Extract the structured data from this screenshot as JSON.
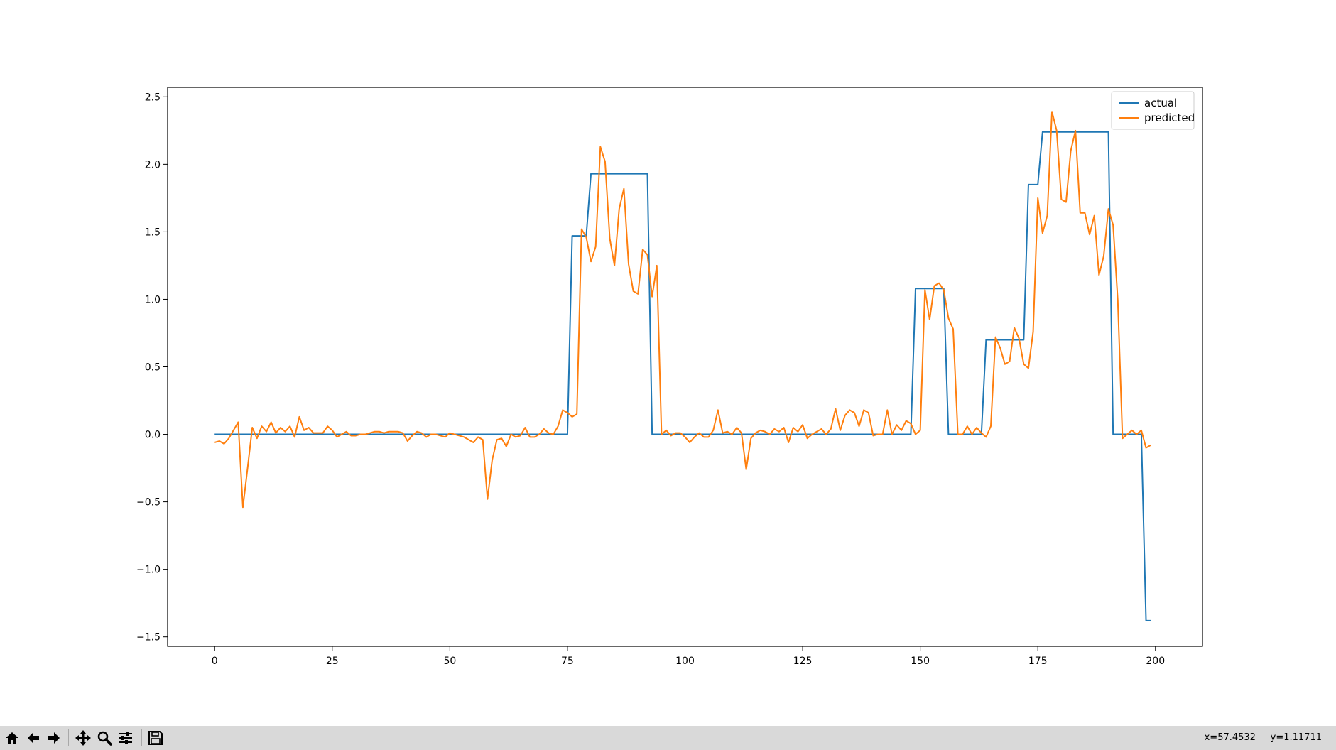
{
  "chart_data": {
    "type": "line",
    "title": "",
    "xlabel": "",
    "ylabel": "",
    "xlim": [
      -10,
      210
    ],
    "ylim": [
      -1.57,
      2.57
    ],
    "xticks": [
      0,
      25,
      50,
      75,
      100,
      125,
      150,
      175,
      200
    ],
    "xtick_labels": [
      "0",
      "25",
      "50",
      "75",
      "100",
      "125",
      "150",
      "175",
      "200"
    ],
    "yticks": [
      -1.5,
      -1.0,
      -0.5,
      0.0,
      0.5,
      1.0,
      1.5,
      2.0,
      2.5
    ],
    "ytick_labels": [
      "−1.5",
      "−1.0",
      "−0.5",
      "0.0",
      "0.5",
      "1.0",
      "1.5",
      "2.0",
      "2.5"
    ],
    "grid": false,
    "legend_position": "top-right",
    "series": [
      {
        "name": "actual",
        "color": "#1f77b4",
        "points": [
          [
            0,
            0
          ],
          [
            75,
            0
          ],
          [
            76,
            1.47
          ],
          [
            79,
            1.47
          ],
          [
            80,
            1.93
          ],
          [
            92,
            1.93
          ],
          [
            93,
            0
          ],
          [
            148,
            0
          ],
          [
            149,
            1.08
          ],
          [
            155,
            1.08
          ],
          [
            156,
            0
          ],
          [
            163,
            0
          ],
          [
            164,
            0.7
          ],
          [
            172,
            0.7
          ],
          [
            173,
            1.85
          ],
          [
            175,
            1.85
          ],
          [
            176,
            2.24
          ],
          [
            190,
            2.24
          ],
          [
            191,
            0
          ],
          [
            197,
            0
          ],
          [
            198,
            -1.38
          ],
          [
            199,
            -1.38
          ]
        ]
      },
      {
        "name": "predicted",
        "color": "#ff7f0e",
        "points": [
          [
            0,
            -0.06
          ],
          [
            1,
            -0.05
          ],
          [
            2,
            -0.07
          ],
          [
            3,
            -0.03
          ],
          [
            4,
            0.03
          ],
          [
            5,
            0.09
          ],
          [
            6,
            -0.54
          ],
          [
            7,
            -0.25
          ],
          [
            8,
            0.05
          ],
          [
            9,
            -0.03
          ],
          [
            10,
            0.06
          ],
          [
            11,
            0.02
          ],
          [
            12,
            0.09
          ],
          [
            13,
            0.01
          ],
          [
            14,
            0.05
          ],
          [
            15,
            0.02
          ],
          [
            16,
            0.06
          ],
          [
            17,
            -0.02
          ],
          [
            18,
            0.13
          ],
          [
            19,
            0.03
          ],
          [
            20,
            0.05
          ],
          [
            21,
            0.01
          ],
          [
            22,
            0.01
          ],
          [
            23,
            0.01
          ],
          [
            24,
            0.06
          ],
          [
            25,
            0.03
          ],
          [
            26,
            -0.02
          ],
          [
            27,
            0.0
          ],
          [
            28,
            0.02
          ],
          [
            29,
            -0.01
          ],
          [
            30,
            -0.01
          ],
          [
            31,
            0.0
          ],
          [
            32,
            0.0
          ],
          [
            33,
            0.01
          ],
          [
            34,
            0.02
          ],
          [
            35,
            0.02
          ],
          [
            36,
            0.01
          ],
          [
            37,
            0.02
          ],
          [
            38,
            0.02
          ],
          [
            39,
            0.02
          ],
          [
            40,
            0.01
          ],
          [
            41,
            -0.05
          ],
          [
            42,
            -0.01
          ],
          [
            43,
            0.02
          ],
          [
            44,
            0.01
          ],
          [
            45,
            -0.02
          ],
          [
            46,
            0.0
          ],
          [
            47,
            0.0
          ],
          [
            48,
            -0.01
          ],
          [
            49,
            -0.02
          ],
          [
            50,
            0.01
          ],
          [
            51,
            0.0
          ],
          [
            52,
            -0.01
          ],
          [
            53,
            -0.02
          ],
          [
            54,
            -0.04
          ],
          [
            55,
            -0.06
          ],
          [
            56,
            -0.02
          ],
          [
            57,
            -0.04
          ],
          [
            58,
            -0.48
          ],
          [
            59,
            -0.19
          ],
          [
            60,
            -0.04
          ],
          [
            61,
            -0.03
          ],
          [
            62,
            -0.09
          ],
          [
            63,
            0.0
          ],
          [
            64,
            -0.02
          ],
          [
            65,
            -0.01
          ],
          [
            66,
            0.05
          ],
          [
            67,
            -0.02
          ],
          [
            68,
            -0.02
          ],
          [
            69,
            0.0
          ],
          [
            70,
            0.04
          ],
          [
            71,
            0.01
          ],
          [
            72,
            0.0
          ],
          [
            73,
            0.06
          ],
          [
            74,
            0.18
          ],
          [
            75,
            0.16
          ],
          [
            76,
            0.13
          ],
          [
            77,
            0.15
          ],
          [
            78,
            1.52
          ],
          [
            79,
            1.46
          ],
          [
            80,
            1.28
          ],
          [
            81,
            1.39
          ],
          [
            82,
            2.13
          ],
          [
            83,
            2.02
          ],
          [
            84,
            1.45
          ],
          [
            85,
            1.25
          ],
          [
            86,
            1.67
          ],
          [
            87,
            1.82
          ],
          [
            88,
            1.26
          ],
          [
            89,
            1.06
          ],
          [
            90,
            1.04
          ],
          [
            91,
            1.37
          ],
          [
            92,
            1.33
          ],
          [
            93,
            1.02
          ],
          [
            94,
            1.25
          ],
          [
            95,
            0.0
          ],
          [
            96,
            0.03
          ],
          [
            97,
            -0.01
          ],
          [
            98,
            0.01
          ],
          [
            99,
            0.01
          ],
          [
            100,
            -0.02
          ],
          [
            101,
            -0.06
          ],
          [
            102,
            -0.02
          ],
          [
            103,
            0.01
          ],
          [
            104,
            -0.02
          ],
          [
            105,
            -0.02
          ],
          [
            106,
            0.03
          ],
          [
            107,
            0.18
          ],
          [
            108,
            0.01
          ],
          [
            109,
            0.02
          ],
          [
            110,
            0.0
          ],
          [
            111,
            0.05
          ],
          [
            112,
            0.01
          ],
          [
            113,
            -0.26
          ],
          [
            114,
            -0.03
          ],
          [
            115,
            0.01
          ],
          [
            116,
            0.03
          ],
          [
            117,
            0.02
          ],
          [
            118,
            0.0
          ],
          [
            119,
            0.04
          ],
          [
            120,
            0.02
          ],
          [
            121,
            0.05
          ],
          [
            122,
            -0.06
          ],
          [
            123,
            0.05
          ],
          [
            124,
            0.02
          ],
          [
            125,
            0.07
          ],
          [
            126,
            -0.03
          ],
          [
            127,
            0.0
          ],
          [
            128,
            0.02
          ],
          [
            129,
            0.04
          ],
          [
            130,
            0.0
          ],
          [
            131,
            0.04
          ],
          [
            132,
            0.19
          ],
          [
            133,
            0.03
          ],
          [
            134,
            0.14
          ],
          [
            135,
            0.18
          ],
          [
            136,
            0.16
          ],
          [
            137,
            0.06
          ],
          [
            138,
            0.18
          ],
          [
            139,
            0.16
          ],
          [
            140,
            -0.01
          ],
          [
            141,
            0.0
          ],
          [
            142,
            0.0
          ],
          [
            143,
            0.18
          ],
          [
            144,
            0.0
          ],
          [
            145,
            0.07
          ],
          [
            146,
            0.03
          ],
          [
            147,
            0.1
          ],
          [
            148,
            0.08
          ],
          [
            149,
            0.0
          ],
          [
            150,
            0.03
          ],
          [
            151,
            1.07
          ],
          [
            152,
            0.85
          ],
          [
            153,
            1.1
          ],
          [
            154,
            1.12
          ],
          [
            155,
            1.07
          ],
          [
            156,
            0.86
          ],
          [
            157,
            0.78
          ],
          [
            158,
            0.0
          ],
          [
            159,
            0.0
          ],
          [
            160,
            0.06
          ],
          [
            161,
            0.0
          ],
          [
            162,
            0.05
          ],
          [
            163,
            0.01
          ],
          [
            164,
            -0.02
          ],
          [
            165,
            0.06
          ],
          [
            166,
            0.72
          ],
          [
            167,
            0.64
          ],
          [
            168,
            0.52
          ],
          [
            169,
            0.54
          ],
          [
            170,
            0.79
          ],
          [
            171,
            0.71
          ],
          [
            172,
            0.52
          ],
          [
            173,
            0.49
          ],
          [
            174,
            0.76
          ],
          [
            175,
            1.75
          ],
          [
            176,
            1.49
          ],
          [
            177,
            1.62
          ],
          [
            178,
            2.39
          ],
          [
            179,
            2.25
          ],
          [
            180,
            1.74
          ],
          [
            181,
            1.72
          ],
          [
            182,
            2.1
          ],
          [
            183,
            2.25
          ],
          [
            184,
            1.64
          ],
          [
            185,
            1.64
          ],
          [
            186,
            1.48
          ],
          [
            187,
            1.62
          ],
          [
            188,
            1.18
          ],
          [
            189,
            1.32
          ],
          [
            190,
            1.67
          ],
          [
            191,
            1.55
          ],
          [
            192,
            0.99
          ],
          [
            193,
            -0.03
          ],
          [
            194,
            0.0
          ],
          [
            195,
            0.03
          ],
          [
            196,
            0.0
          ],
          [
            197,
            0.03
          ],
          [
            198,
            -0.1
          ],
          [
            199,
            -0.08
          ]
        ]
      }
    ]
  },
  "toolbar": {
    "buttons": [
      {
        "name": "home-button",
        "icon": "home-icon"
      },
      {
        "name": "back-button",
        "icon": "arrow-left-icon"
      },
      {
        "name": "forward-button",
        "icon": "arrow-right-icon"
      },
      {
        "name": "pan-button",
        "icon": "move-icon"
      },
      {
        "name": "zoom-button",
        "icon": "magnifier-icon"
      },
      {
        "name": "configure-subplots-button",
        "icon": "sliders-icon"
      },
      {
        "name": "save-button",
        "icon": "floppy-disk-icon"
      }
    ],
    "coords_x": "x=57.4532",
    "coords_y": "y=1.11711"
  }
}
